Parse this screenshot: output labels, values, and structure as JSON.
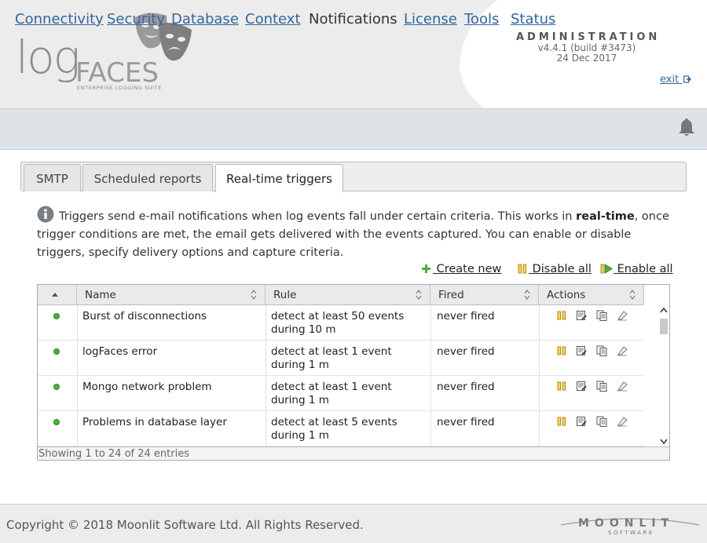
{
  "header": {
    "logo_log": "log",
    "logo_faces": "FACES",
    "logo_subtitle": "ENTERPRISE LOGGING SUITE",
    "admin_title": "ADMINISTRATION",
    "version": "v4.4.1 (build #3473)",
    "date": "24 Dec 2017",
    "exit_label": "exit"
  },
  "nav": {
    "items": [
      {
        "label": "Connectivity",
        "active": false
      },
      {
        "label": "Security",
        "active": false
      },
      {
        "label": "Database",
        "active": false
      },
      {
        "label": "Context",
        "active": false
      },
      {
        "label": "Notifications",
        "active": true
      },
      {
        "label": "License",
        "active": false
      },
      {
        "label": "Tools",
        "active": false
      },
      {
        "label": "Status",
        "active": false
      }
    ]
  },
  "tabs": [
    {
      "label": "SMTP"
    },
    {
      "label": "Scheduled reports"
    },
    {
      "label": "Real-time triggers",
      "active": true
    }
  ],
  "info": {
    "text_before": "Triggers send e-mail notifications when log events fall under certain criteria. This works in ",
    "text_bold": "real-time",
    "text_after": ", once trigger conditions are met, the email gets delivered with the events captured. You can enable or disable triggers, specify delivery options and capture criteria."
  },
  "toolbar": {
    "create_new": "Create new",
    "disable_all": "Disable all",
    "enable_all": "Enable all"
  },
  "table": {
    "columns": [
      "Name",
      "Rule",
      "Fired",
      "Actions"
    ],
    "rows": [
      {
        "name": "Burst of disconnections",
        "rule_line1": "detect at least 50 events",
        "rule_line2": "during 10 m",
        "fired": "never fired"
      },
      {
        "name": "logFaces error",
        "rule_line1": "detect at least 1 event",
        "rule_line2": "during 1 m",
        "fired": "never fired"
      },
      {
        "name": "Mongo network problem",
        "rule_line1": "detect at least 1 event",
        "rule_line2": "during 1 m",
        "fired": "never fired"
      },
      {
        "name": "Problems in database layer",
        "rule_line1": "detect at least 5 events",
        "rule_line2": "during 1 m",
        "fired": "never fired"
      }
    ],
    "footer": "Showing 1 to 24 of 24 entries"
  },
  "footer": {
    "copyright": "Copyright © 2018 Moonlit Software Ltd. All Rights Reserved.",
    "brand": "MOONLIT",
    "brand_sub": "SOFTWARE"
  },
  "colors": {
    "link": "#336699",
    "status_green": "#4caf3c",
    "nav_bg": "#dde3e6"
  }
}
